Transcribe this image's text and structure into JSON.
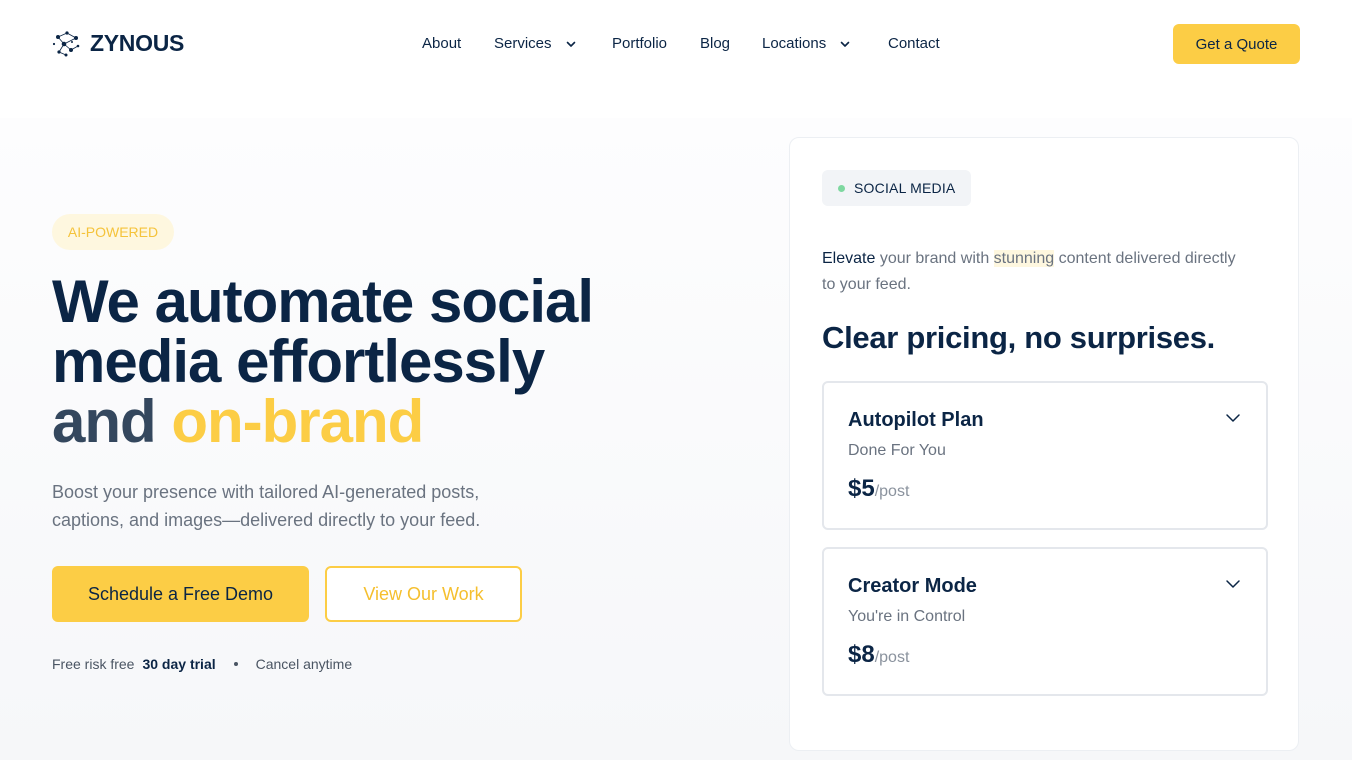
{
  "brand": {
    "name": "ZYNOUS",
    "logo_icon": "constellation-dots-icon"
  },
  "nav": {
    "items": [
      {
        "label": "About",
        "has_dropdown": false
      },
      {
        "label": "Services",
        "has_dropdown": true
      },
      {
        "label": "Portfolio",
        "has_dropdown": false
      },
      {
        "label": "Blog",
        "has_dropdown": false
      },
      {
        "label": "Locations",
        "has_dropdown": true
      },
      {
        "label": "Contact",
        "has_dropdown": false
      }
    ],
    "cta_label": "Get a Quote"
  },
  "hero": {
    "badge": "AI-POWERED",
    "headline_line1": "We automate social",
    "headline_line2": "media effortlessly",
    "headline_and": "and ",
    "headline_accent": "on-brand",
    "subtext": "Boost your presence with tailored AI-generated posts, captions, and images—delivered directly to your feed.",
    "primary_cta": "Schedule a Free Demo",
    "secondary_cta": "View Our Work",
    "trial_prefix": "Free risk free",
    "trial_strong": "30 day trial",
    "cancel_text": "Cancel anytime"
  },
  "card": {
    "tag": "SOCIAL MEDIA",
    "intro_first": "Elevate",
    "intro_mid": " your brand with ",
    "intro_highlight": "stunning",
    "intro_rest": " content delivered directly to your feed.",
    "pricing_title": "Clear pricing, no surprises.",
    "plans": [
      {
        "name": "Autopilot Plan",
        "subtitle": "Done For You",
        "price": "$5",
        "unit": "/post"
      },
      {
        "name": "Creator Mode",
        "subtitle": "You're in Control",
        "price": "$8",
        "unit": "/post"
      }
    ]
  },
  "colors": {
    "navy": "#0b2545",
    "accent_yellow": "#fccd45",
    "muted_text": "#6a7380",
    "status_green": "#7ed8a0"
  }
}
